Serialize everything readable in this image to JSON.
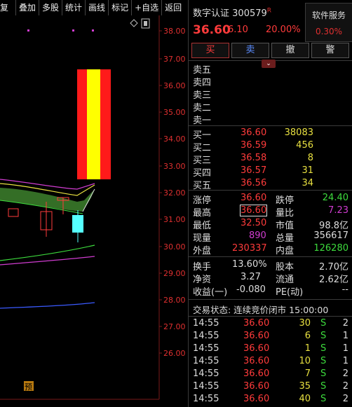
{
  "toolbar": {
    "items": [
      "复权",
      "叠加",
      "多股",
      "统计",
      "画线",
      "标记",
      "+自选",
      "返回"
    ]
  },
  "chart": {
    "y_ticks": [
      "38.00",
      "37.00",
      "36.00",
      "35.00",
      "34.00",
      "33.00",
      "32.00",
      "31.00",
      "30.00",
      "29.00",
      "28.00",
      "27.00",
      "26.00"
    ],
    "yu_label": "预"
  },
  "stock": {
    "name": "数字认证",
    "code": "300579",
    "badge": "R",
    "price": "36.60",
    "change": "6.10",
    "change_pct": "20.00%",
    "service_label": "软件服务",
    "service_pct": "0.30%"
  },
  "actions": {
    "buy": "买",
    "sell": "卖",
    "cancel": "撤",
    "alert": "警"
  },
  "ask": [
    {
      "label": "卖五",
      "price": "",
      "vol": ""
    },
    {
      "label": "卖四",
      "price": "",
      "vol": ""
    },
    {
      "label": "卖三",
      "price": "",
      "vol": ""
    },
    {
      "label": "卖二",
      "price": "",
      "vol": ""
    },
    {
      "label": "卖一",
      "price": "",
      "vol": ""
    }
  ],
  "bid": [
    {
      "label": "买一",
      "price": "36.60",
      "vol": "38083"
    },
    {
      "label": "买二",
      "price": "36.59",
      "vol": "456"
    },
    {
      "label": "买三",
      "price": "36.58",
      "vol": "8"
    },
    {
      "label": "买四",
      "price": "36.57",
      "vol": "31"
    },
    {
      "label": "买五",
      "price": "36.56",
      "vol": "34"
    }
  ],
  "stats": {
    "zhangting_label": "涨停",
    "zhangting": "36.60",
    "dieting_label": "跌停",
    "dieting": "24.40",
    "zuigao_label": "最高",
    "zuigao": "36.60",
    "liangbi_label": "量比",
    "liangbi": "7.23",
    "zuidi_label": "最低",
    "zuidi": "32.50",
    "shizhi_label": "市值",
    "shizhi": "98.8亿",
    "xianliang_label": "现量",
    "xianliang": "890",
    "zongliang_label": "总量",
    "zongliang": "356617",
    "waipan_label": "外盘",
    "waipan": "230337",
    "neipan_label": "内盘",
    "neipan": "126280",
    "huanshou_label": "换手",
    "huanshou": "13.60%",
    "guben_label": "股本",
    "guben": "2.70亿",
    "jingzi_label": "净资",
    "jingzi": "3.27",
    "liutong_label": "流通",
    "liutong": "2.62亿",
    "shouyi_label": "收益(一)",
    "shouyi": "-0.080",
    "pe_label": "PE(动)",
    "pe": "--"
  },
  "trade_status": "交易状态: 连续竞价闭市 15:00:00",
  "ticks": [
    {
      "time": "14:55",
      "price": "36.60",
      "vol": "30",
      "side": "S",
      "n": "2"
    },
    {
      "time": "14:55",
      "price": "36.60",
      "vol": "6",
      "side": "S",
      "n": "1"
    },
    {
      "time": "14:55",
      "price": "36.60",
      "vol": "1",
      "side": "S",
      "n": "1"
    },
    {
      "time": "14:55",
      "price": "36.60",
      "vol": "10",
      "side": "S",
      "n": "1"
    },
    {
      "time": "14:55",
      "price": "36.60",
      "vol": "7",
      "side": "S",
      "n": "2"
    },
    {
      "time": "14:55",
      "price": "36.60",
      "vol": "35",
      "side": "S",
      "n": "2"
    },
    {
      "time": "14:55",
      "price": "36.60",
      "vol": "40",
      "side": "S",
      "n": "2"
    }
  ]
}
